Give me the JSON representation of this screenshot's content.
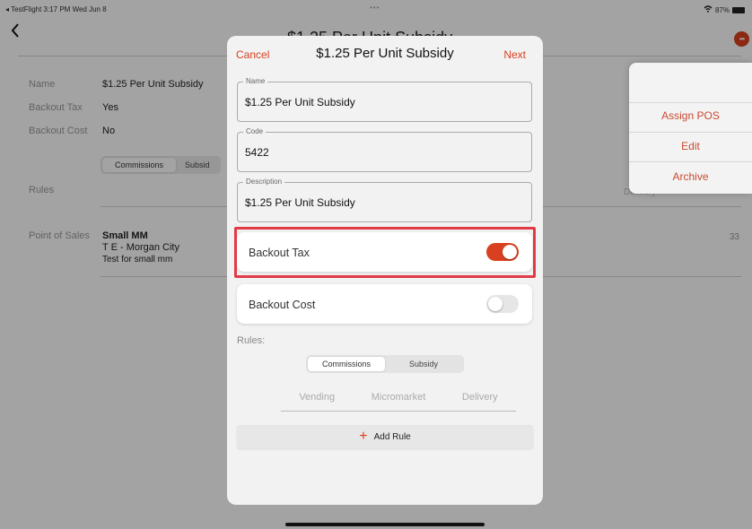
{
  "status_bar": {
    "left": "◂ TestFlight  3:17 PM  Wed Jun 8",
    "dots": "•••",
    "battery": "87%"
  },
  "background": {
    "back_icon": "chevron-left-icon",
    "title": "$1.25 Per Unit Subsidy",
    "avatar_initials": "•••",
    "fields": [
      {
        "label": "Name",
        "value": "$1.25 Per Unit Subsidy"
      },
      {
        "label": "Backout Tax",
        "value": "Yes"
      },
      {
        "label": "Backout Cost",
        "value": "No"
      }
    ],
    "segment": {
      "selected": "Commissions",
      "other": "Subsid"
    },
    "rules_label": "Rules",
    "delivery_label": "Delivery",
    "point_of_sales_label": "Point of Sales",
    "pos": {
      "name": "Small MM",
      "location": "T E - Morgan City",
      "note": "Test for small mm"
    },
    "pos_count": "33"
  },
  "menu": {
    "items": [
      "Assign POS",
      "Edit",
      "Archive"
    ]
  },
  "modal": {
    "cancel": "Cancel",
    "title": "$1.25 Per Unit Subsidy",
    "next": "Next",
    "fields": [
      {
        "label": "Name",
        "value": "$1.25 Per Unit Subsidy"
      },
      {
        "label": "Code",
        "value": "5422"
      },
      {
        "label": "Description",
        "value": "$1.25 Per Unit Subsidy"
      }
    ],
    "toggles": [
      {
        "label": "Backout Tax",
        "on": true
      },
      {
        "label": "Backout Cost",
        "on": false
      }
    ],
    "rules_label": "Rules:",
    "segment": {
      "selected": "Commissions",
      "other": "Subsidy"
    },
    "subtabs": [
      "Vending",
      "Micromarket",
      "Delivery"
    ],
    "add_rule": "Add Rule"
  },
  "colors": {
    "accent": "#d9401f",
    "highlight": "#e03b46"
  }
}
